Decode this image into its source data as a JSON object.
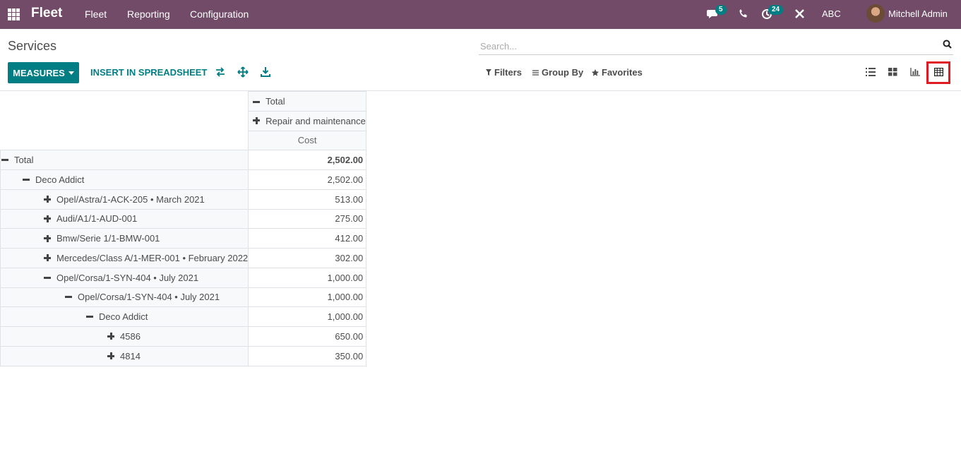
{
  "navbar": {
    "brand": "Fleet",
    "menu": [
      "Fleet",
      "Reporting",
      "Configuration"
    ],
    "messages_badge": "5",
    "activities_badge": "24",
    "company": "ABC",
    "user": "Mitchell Admin",
    "icons": [
      "apps-icon",
      "chat-icon",
      "phone-icon",
      "activity-icon",
      "tools-icon"
    ]
  },
  "control_panel": {
    "title": "Services",
    "search_placeholder": "Search...",
    "measures_label": "MEASURES",
    "insert_label": "INSERT IN SPREADSHEET",
    "filters_label": "Filters",
    "groupby_label": "Group By",
    "favorites_label": "Favorites",
    "views": [
      "list-view",
      "kanban-view",
      "graph-view",
      "pivot-view"
    ],
    "active_view": "pivot-view",
    "accent": "#017e84",
    "nav_color": "#714b67",
    "highlight": "#e01b24"
  },
  "pivot": {
    "col_total": "Total",
    "col_group": "Repair and maintenance",
    "measure": "Cost",
    "rows": [
      {
        "label": "Total",
        "value": "2,502.00",
        "level": 0,
        "expanded": true,
        "bold": true
      },
      {
        "label": "Deco Addict",
        "value": "2,502.00",
        "level": 1,
        "expanded": true
      },
      {
        "label": "Opel/Astra/1-ACK-205 • March 2021",
        "value": "513.00",
        "level": 2,
        "expanded": false
      },
      {
        "label": "Audi/A1/1-AUD-001",
        "value": "275.00",
        "level": 2,
        "expanded": false
      },
      {
        "label": "Bmw/Serie 1/1-BMW-001",
        "value": "412.00",
        "level": 2,
        "expanded": false
      },
      {
        "label": "Mercedes/Class A/1-MER-001 • February 2022",
        "value": "302.00",
        "level": 2,
        "expanded": false
      },
      {
        "label": "Opel/Corsa/1-SYN-404 • July 2021",
        "value": "1,000.00",
        "level": 2,
        "expanded": true
      },
      {
        "label": "Opel/Corsa/1-SYN-404 • July 2021",
        "value": "1,000.00",
        "level": 3,
        "expanded": true
      },
      {
        "label": "Deco Addict",
        "value": "1,000.00",
        "level": 4,
        "expanded": true
      },
      {
        "label": "4586",
        "value": "650.00",
        "level": 5,
        "expanded": false
      },
      {
        "label": "4814",
        "value": "350.00",
        "level": 5,
        "expanded": false
      }
    ]
  }
}
